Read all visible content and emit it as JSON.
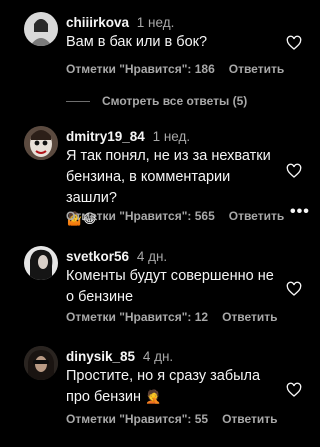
{
  "comments": [
    {
      "username": "chiiirkova",
      "time": "1 нед.",
      "text": "Вам в бак или в бок?",
      "likes": "Отметки \"Нравится\": 186",
      "reply": "Ответить"
    },
    {
      "username": "dmitry19_84",
      "time": "1 нед.",
      "text": "Я так понял, не из за нехватки бензина, в комментарии зашли?",
      "emoji": "🤷😂",
      "likes": "Отметки \"Нравится\": 565",
      "reply": "Ответить",
      "more": "•••"
    },
    {
      "username": "svetkor56",
      "time": "4 дн.",
      "text": "Коменты будут совершенно не о бензине",
      "likes": "Отметки \"Нравится\": 12",
      "reply": "Ответить"
    },
    {
      "username": "dinysik_85",
      "time": "4 дн.",
      "text": "Простите, но я сразу забыла про бензин",
      "emoji": "🤦",
      "likes": "Отметки \"Нравится\": 55",
      "reply": "Ответить"
    }
  ],
  "view_replies": "Смотреть все ответы (5)",
  "icons": {
    "heart": "heart-outline-icon",
    "more": "more-dots-icon"
  },
  "colors": {
    "background": "#000000",
    "text": "#f5f5f5",
    "secondary": "#a8a8a8"
  }
}
